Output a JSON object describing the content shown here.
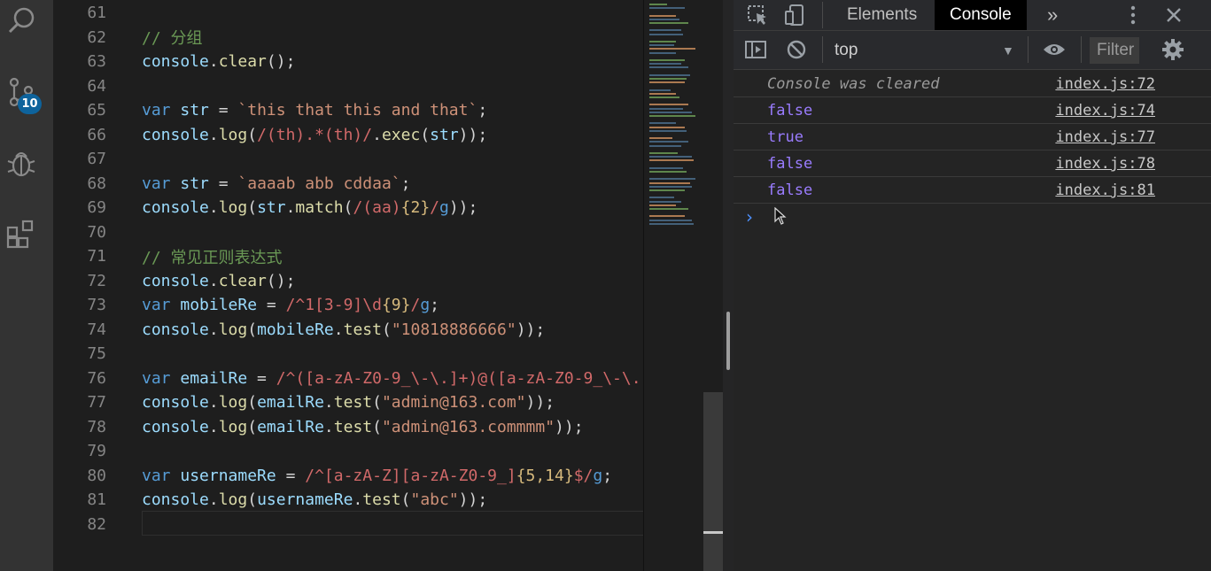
{
  "activity_bar": {
    "icons": [
      "search-icon",
      "source-control-icon",
      "debug-icon",
      "extensions-icon"
    ],
    "scm_badge": "10"
  },
  "editor": {
    "lines": [
      {
        "num": "61",
        "tokens": []
      },
      {
        "num": "62",
        "tokens": [
          {
            "t": "// 分组",
            "c": "cm"
          }
        ]
      },
      {
        "num": "63",
        "tokens": [
          {
            "t": "console",
            "c": "vr"
          },
          {
            "t": ".",
            "c": "pn"
          },
          {
            "t": "clear",
            "c": "fn"
          },
          {
            "t": "();",
            "c": "pn"
          }
        ]
      },
      {
        "num": "64",
        "tokens": []
      },
      {
        "num": "65",
        "tokens": [
          {
            "t": "var",
            "c": "kw"
          },
          {
            "t": " ",
            "c": "pn"
          },
          {
            "t": "str",
            "c": "vr"
          },
          {
            "t": " = ",
            "c": "op"
          },
          {
            "t": "`this that this and that`",
            "c": "st"
          },
          {
            "t": ";",
            "c": "pn"
          }
        ]
      },
      {
        "num": "66",
        "tokens": [
          {
            "t": "console",
            "c": "vr"
          },
          {
            "t": ".",
            "c": "pn"
          },
          {
            "t": "log",
            "c": "fn"
          },
          {
            "t": "(",
            "c": "pn"
          },
          {
            "t": "/(th).*(th)/",
            "c": "rx"
          },
          {
            "t": ".",
            "c": "pn"
          },
          {
            "t": "exec",
            "c": "fn"
          },
          {
            "t": "(",
            "c": "pn"
          },
          {
            "t": "str",
            "c": "vr"
          },
          {
            "t": "));",
            "c": "pn"
          }
        ]
      },
      {
        "num": "67",
        "tokens": []
      },
      {
        "num": "68",
        "tokens": [
          {
            "t": "var",
            "c": "kw"
          },
          {
            "t": " ",
            "c": "pn"
          },
          {
            "t": "str",
            "c": "vr"
          },
          {
            "t": " = ",
            "c": "op"
          },
          {
            "t": "`aaaab abb cddaa`",
            "c": "st"
          },
          {
            "t": ";",
            "c": "pn"
          }
        ]
      },
      {
        "num": "69",
        "tokens": [
          {
            "t": "console",
            "c": "vr"
          },
          {
            "t": ".",
            "c": "pn"
          },
          {
            "t": "log",
            "c": "fn"
          },
          {
            "t": "(",
            "c": "pn"
          },
          {
            "t": "str",
            "c": "vr"
          },
          {
            "t": ".",
            "c": "pn"
          },
          {
            "t": "match",
            "c": "fn"
          },
          {
            "t": "(",
            "c": "pn"
          },
          {
            "t": "/(aa)",
            "c": "rx"
          },
          {
            "t": "{2}",
            "c": "rxd"
          },
          {
            "t": "/",
            "c": "rx"
          },
          {
            "t": "g",
            "c": "kw"
          },
          {
            "t": "));",
            "c": "pn"
          }
        ]
      },
      {
        "num": "70",
        "tokens": []
      },
      {
        "num": "71",
        "tokens": [
          {
            "t": "// 常见正则表达式",
            "c": "cm"
          }
        ]
      },
      {
        "num": "72",
        "tokens": [
          {
            "t": "console",
            "c": "vr"
          },
          {
            "t": ".",
            "c": "pn"
          },
          {
            "t": "clear",
            "c": "fn"
          },
          {
            "t": "();",
            "c": "pn"
          }
        ]
      },
      {
        "num": "73",
        "tokens": [
          {
            "t": "var",
            "c": "kw"
          },
          {
            "t": " ",
            "c": "pn"
          },
          {
            "t": "mobileRe",
            "c": "vr"
          },
          {
            "t": " = ",
            "c": "op"
          },
          {
            "t": "/^1[3-9]\\d",
            "c": "rx"
          },
          {
            "t": "{9}",
            "c": "rxd"
          },
          {
            "t": "/",
            "c": "rx"
          },
          {
            "t": "g",
            "c": "kw"
          },
          {
            "t": ";",
            "c": "pn"
          }
        ]
      },
      {
        "num": "74",
        "tokens": [
          {
            "t": "console",
            "c": "vr"
          },
          {
            "t": ".",
            "c": "pn"
          },
          {
            "t": "log",
            "c": "fn"
          },
          {
            "t": "(",
            "c": "pn"
          },
          {
            "t": "mobileRe",
            "c": "vr"
          },
          {
            "t": ".",
            "c": "pn"
          },
          {
            "t": "test",
            "c": "fn"
          },
          {
            "t": "(",
            "c": "pn"
          },
          {
            "t": "\"10818886666\"",
            "c": "st"
          },
          {
            "t": "));",
            "c": "pn"
          }
        ]
      },
      {
        "num": "75",
        "tokens": []
      },
      {
        "num": "76",
        "tokens": [
          {
            "t": "var",
            "c": "kw"
          },
          {
            "t": " ",
            "c": "pn"
          },
          {
            "t": "emailRe",
            "c": "vr"
          },
          {
            "t": " = ",
            "c": "op"
          },
          {
            "t": "/^([a-zA-Z0-9_\\-\\.]+)@([a-zA-Z0-9_\\-\\.",
            "c": "rx"
          }
        ]
      },
      {
        "num": "77",
        "tokens": [
          {
            "t": "console",
            "c": "vr"
          },
          {
            "t": ".",
            "c": "pn"
          },
          {
            "t": "log",
            "c": "fn"
          },
          {
            "t": "(",
            "c": "pn"
          },
          {
            "t": "emailRe",
            "c": "vr"
          },
          {
            "t": ".",
            "c": "pn"
          },
          {
            "t": "test",
            "c": "fn"
          },
          {
            "t": "(",
            "c": "pn"
          },
          {
            "t": "\"admin@163.com\"",
            "c": "st"
          },
          {
            "t": "));",
            "c": "pn"
          }
        ]
      },
      {
        "num": "78",
        "tokens": [
          {
            "t": "console",
            "c": "vr"
          },
          {
            "t": ".",
            "c": "pn"
          },
          {
            "t": "log",
            "c": "fn"
          },
          {
            "t": "(",
            "c": "pn"
          },
          {
            "t": "emailRe",
            "c": "vr"
          },
          {
            "t": ".",
            "c": "pn"
          },
          {
            "t": "test",
            "c": "fn"
          },
          {
            "t": "(",
            "c": "pn"
          },
          {
            "t": "\"admin@163.commmm\"",
            "c": "st"
          },
          {
            "t": "));",
            "c": "pn"
          }
        ]
      },
      {
        "num": "79",
        "tokens": []
      },
      {
        "num": "80",
        "tokens": [
          {
            "t": "var",
            "c": "kw"
          },
          {
            "t": " ",
            "c": "pn"
          },
          {
            "t": "usernameRe",
            "c": "vr"
          },
          {
            "t": " = ",
            "c": "op"
          },
          {
            "t": "/^[a-zA-Z][a-zA-Z0-9_]",
            "c": "rx"
          },
          {
            "t": "{5,14}",
            "c": "rxd"
          },
          {
            "t": "$/",
            "c": "rx"
          },
          {
            "t": "g",
            "c": "kw"
          },
          {
            "t": ";",
            "c": "pn"
          }
        ]
      },
      {
        "num": "81",
        "tokens": [
          {
            "t": "console",
            "c": "vr"
          },
          {
            "t": ".",
            "c": "pn"
          },
          {
            "t": "log",
            "c": "fn"
          },
          {
            "t": "(",
            "c": "pn"
          },
          {
            "t": "usernameRe",
            "c": "vr"
          },
          {
            "t": ".",
            "c": "pn"
          },
          {
            "t": "test",
            "c": "fn"
          },
          {
            "t": "(",
            "c": "pn"
          },
          {
            "t": "\"abc\"",
            "c": "st"
          },
          {
            "t": "));",
            "c": "pn"
          }
        ]
      },
      {
        "num": "82",
        "tokens": []
      }
    ]
  },
  "devtools": {
    "tabs": {
      "elements": "Elements",
      "console": "Console",
      "more": "»"
    },
    "toolbar": {
      "context": "top",
      "filter_placeholder": "Filter"
    },
    "console_rows": [
      {
        "message": "Console was cleared",
        "kind": "cleared",
        "source": "index.js:72"
      },
      {
        "message": "false",
        "kind": "bool",
        "source": "index.js:74"
      },
      {
        "message": "true",
        "kind": "bool",
        "source": "index.js:77"
      },
      {
        "message": "false",
        "kind": "bool",
        "source": "index.js:78"
      },
      {
        "message": "false",
        "kind": "bool",
        "source": "index.js:81"
      }
    ],
    "prompt": "›"
  }
}
